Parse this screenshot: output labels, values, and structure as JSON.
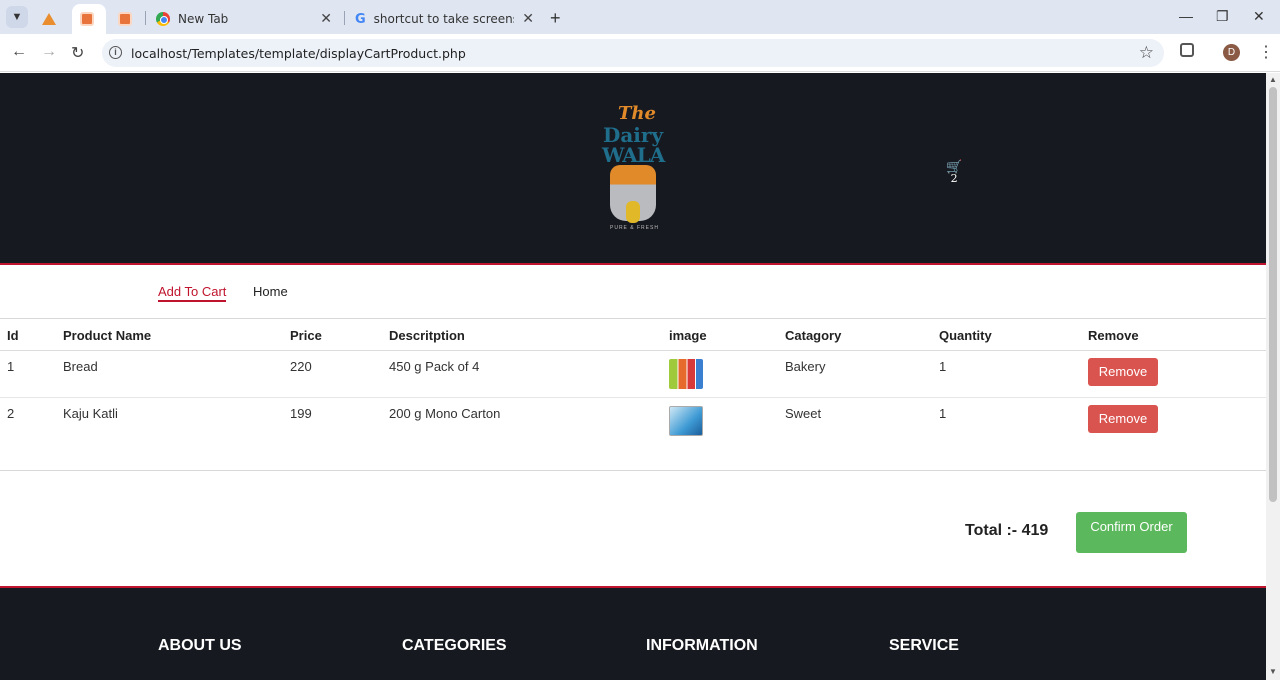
{
  "browser": {
    "tabs": [
      {
        "title": "",
        "icon": "xampp-icon"
      },
      {
        "title": "",
        "icon": "xampp-icon"
      },
      {
        "title": "",
        "icon": "xampp-icon"
      },
      {
        "title": "New Tab",
        "icon": "chrome-icon"
      },
      {
        "title": "shortcut to take screenshot in w",
        "icon": "google-icon"
      }
    ],
    "url": "localhost/Templates/template/displayCartProduct.php",
    "profile_initial": "D"
  },
  "header": {
    "logo": {
      "line1": "The",
      "line2": "Dairy",
      "line3": "WALA",
      "tagline": "PURE & FRESH"
    },
    "cart_count": "2"
  },
  "subnav": {
    "items": [
      "Add To Cart",
      "Home"
    ]
  },
  "cart": {
    "columns": [
      "Id",
      "Product Name",
      "Price",
      "Descritption",
      "image",
      "Catagory",
      "Quantity",
      "Remove"
    ],
    "rows": [
      {
        "id": "1",
        "name": "Bread",
        "price": "220",
        "description": "450 g Pack of 4",
        "category": "Bakery",
        "quantity": "1",
        "remove": "Remove"
      },
      {
        "id": "2",
        "name": "Kaju Katli",
        "price": "199",
        "description": "200 g Mono Carton",
        "category": "Sweet",
        "quantity": "1",
        "remove": "Remove"
      }
    ],
    "total": "Total :- 419",
    "confirm": "Confirm Order"
  },
  "footer": {
    "headings": [
      "ABOUT US",
      "CATEGORIES",
      "INFORMATION",
      "SERVICE"
    ]
  },
  "colors": {
    "header_bg": "#171920",
    "accent_red": "#c0142e",
    "remove_btn": "#d9534f",
    "confirm_btn": "#5cb85c"
  }
}
